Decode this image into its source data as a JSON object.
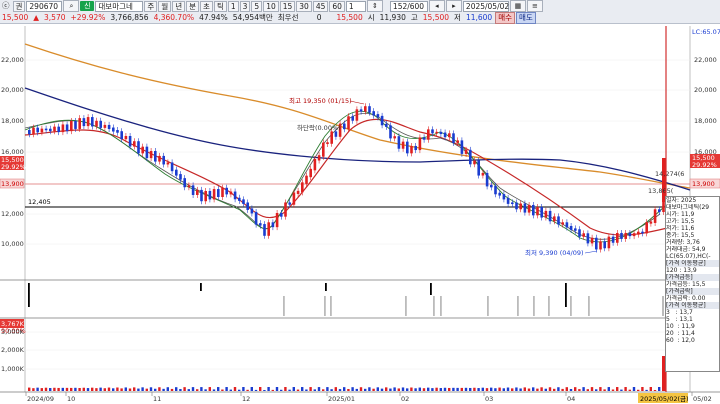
{
  "toolbar": {
    "row1": {
      "prefix": "ⓒ",
      "code_label": "권",
      "code_value": "290670",
      "search_icon": "search-icon",
      "stock_badge": "신",
      "stock_name": "대보마그네",
      "buttons": [
        "주",
        "월",
        "년",
        "분",
        "초",
        "틱"
      ],
      "periods": [
        "1",
        "3",
        "5",
        "10",
        "15",
        "30",
        "45",
        "60"
      ],
      "tick_value": "1",
      "count": "152/600",
      "date": "2025/05/02"
    },
    "row2": {
      "price": "15,500",
      "change_arrow": "▲",
      "change": "3,570",
      "change_pct": "+29.92%",
      "volume": "3,766,856",
      "volume_pct": "4,360.70%",
      "turnover_pct": "47.94%",
      "amount": "54,954백만",
      "low_label": "최우선",
      "low_value": "0",
      "open_value": "15,500",
      "open_label": "시",
      "high_label": "고",
      "high_value": "11,930",
      "high_price": "15,500",
      "low2_label": "저",
      "low2_value": "11,600",
      "buy": "매수",
      "sell": "매도"
    }
  },
  "chart": {
    "y_left_labels": [
      "22,000",
      "20,000",
      "18,000",
      "16,000",
      "14,000",
      "12,000",
      "10,000"
    ],
    "y_right_labels": [
      "22,000",
      "20,000",
      "18,000",
      "16,000",
      "14,000",
      "12,000",
      "10,000"
    ],
    "price_tag_left": "15,500",
    "price_tag_left_pct": "29.92%",
    "ref_tag_left": "13,900",
    "ref_tag_right": "13,900",
    "price_tag_right": "15,500",
    "price_tag_right_pct": "29.92%",
    "hline_label": "12,405",
    "high_annot": "최고 19,350 (01/15)",
    "drop_annot": "하단락(0.00%)",
    "low_annot": "최저 9,390 (04/09)",
    "tip_annot": "14,274(6",
    "tip_annot2": "13,865(",
    "lc_label_line1": "LC:65.07",
    "lc_label_line2": "HC:-19.96",
    "volume_axis": [
      "3,000K",
      "2,000K",
      "1,000K"
    ],
    "volume_top_left": "3,767K",
    "volume_top_left2": "90.00%",
    "x_labels": [
      "2024/09",
      "10",
      "11",
      "12",
      "2025/01",
      "02",
      "03",
      "04",
      "05/02"
    ],
    "x_last_tag": "2025/05/02(금)"
  },
  "info_panel": {
    "rows": [
      {
        "k": "일자",
        "v": ": 2025"
      },
      {
        "k": "대보마그네틱(29",
        "v": ""
      },
      {
        "k": "시가",
        "v": ": 11,9"
      },
      {
        "k": "고가",
        "v": ": 15,5"
      },
      {
        "k": "저가",
        "v": ": 11,6"
      },
      {
        "k": "종가",
        "v": ": 15,5"
      },
      {
        "k": "거래량",
        "v": ": 3,76"
      },
      {
        "k": "거래대금",
        "v": ": 54,9"
      },
      {
        "k": "LC(65.07),HC(-",
        "v": ""
      }
    ],
    "section1": "[가격 이동평균]",
    "s1_rows": [
      {
        "k": "120",
        "v": ": 13,9"
      }
    ],
    "section2": "[가격급등]",
    "s2_rows": [
      {
        "k": "가격급등",
        "v": ": 15,5"
      }
    ],
    "section3": "[가격급락]",
    "s3_rows": [
      {
        "k": "가격급락",
        "v": ": 0.00"
      }
    ],
    "section4": "[가격 이동평균]",
    "s4_rows": [
      {
        "k": "3",
        "v": ": 13,7"
      },
      {
        "k": "5",
        "v": ": 13,1"
      },
      {
        "k": "10",
        "v": ": 11,9"
      },
      {
        "k": "20",
        "v": ": 11,4"
      },
      {
        "k": "60",
        "v": ": 12,0"
      }
    ]
  },
  "colors": {
    "up": "#e02020",
    "down": "#1a3cd0",
    "ma_orange": "#d98c2b",
    "ma_navy": "#1a237e",
    "ma_red": "#c62828",
    "ma_green": "#2e7d32"
  }
}
